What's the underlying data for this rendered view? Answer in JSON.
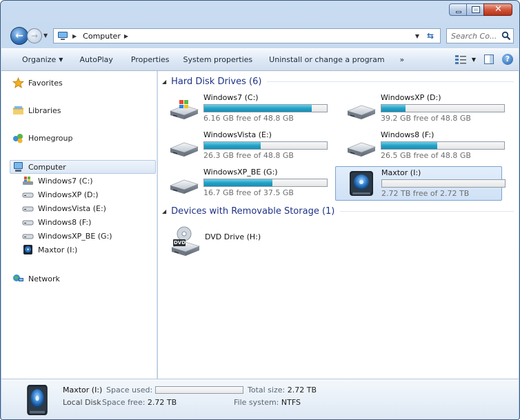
{
  "window": {
    "caption_buttons": [
      "minimize",
      "maximize",
      "close"
    ]
  },
  "address_bar": {
    "location": "Computer",
    "search_placeholder": "Search Co..."
  },
  "toolbar": {
    "organize": "Organize",
    "autoplay": "AutoPlay",
    "properties": "Properties",
    "system_properties": "System properties",
    "uninstall": "Uninstall or change a program",
    "overflow": "»"
  },
  "nav": {
    "favorites": "Favorites",
    "libraries": "Libraries",
    "homegroup": "Homegroup",
    "computer": "Computer",
    "drives": [
      {
        "label": "Windows7 (C:)",
        "icon": "windows-drive-icon"
      },
      {
        "label": "WindowsXP (D:)",
        "icon": "hard-drive-icon"
      },
      {
        "label": "WindowsVista (E:)",
        "icon": "hard-drive-icon"
      },
      {
        "label": "Windows8 (F:)",
        "icon": "hard-drive-icon"
      },
      {
        "label": "WindowsXP_BE (G:)",
        "icon": "hard-drive-icon"
      },
      {
        "label": "Maxtor (I:)",
        "icon": "external-drive-icon"
      }
    ],
    "network": "Network"
  },
  "content": {
    "hdd_group": "Hard Disk Drives (6)",
    "removable_group": "Devices with Removable Storage (1)",
    "drives": [
      {
        "name": "Windows7 (C:)",
        "free": "6.16 GB free of 48.8 GB",
        "used_fraction": 0.874,
        "icon": "windows-drive-icon"
      },
      {
        "name": "WindowsXP (D:)",
        "free": "39.2 GB free of 48.8 GB",
        "used_fraction": 0.197,
        "icon": "hard-drive-icon"
      },
      {
        "name": "WindowsVista (E:)",
        "free": "26.3 GB free of 48.8 GB",
        "used_fraction": 0.461,
        "icon": "hard-drive-icon"
      },
      {
        "name": "Windows8 (F:)",
        "free": "26.5 GB free of 48.8 GB",
        "used_fraction": 0.457,
        "icon": "hard-drive-icon"
      },
      {
        "name": "WindowsXP_BE (G:)",
        "free": "16.7 GB free of 37.5 GB",
        "used_fraction": 0.555,
        "icon": "hard-drive-icon"
      },
      {
        "name": "Maxtor (I:)",
        "free": "2.72 TB free of 2.72 TB",
        "used_fraction": 0.0,
        "icon": "external-drive-icon"
      }
    ],
    "dvd": {
      "name": "DVD Drive (H:)",
      "badge": "DVD"
    }
  },
  "details": {
    "name": "Maxtor (I:)",
    "type": "Local Disk",
    "space_used_label": "Space used:",
    "space_used_fraction": 0.0,
    "space_free_label": "Space free:",
    "space_free_value": "2.72 TB",
    "total_size_label": "Total size:",
    "total_size_value": "2.72 TB",
    "file_system_label": "File system:",
    "file_system_value": "NTFS"
  },
  "colors": {
    "group_header": "#1e3287",
    "bar_fill": "#24a3c8",
    "selection": "#cfe1f6"
  }
}
